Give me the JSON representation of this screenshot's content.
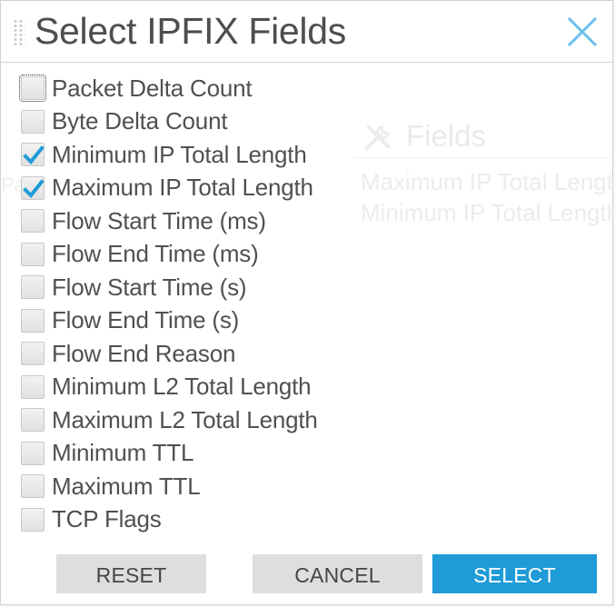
{
  "dialog": {
    "title": "Select IPFIX Fields",
    "close_icon": "close-icon",
    "accent_color": "#1f9bd7"
  },
  "fields": [
    {
      "label": "Packet Delta Count",
      "checked": false,
      "focused": true
    },
    {
      "label": "Byte Delta Count",
      "checked": false,
      "focused": false
    },
    {
      "label": "Minimum IP Total Length",
      "checked": true,
      "focused": false
    },
    {
      "label": "Maximum IP Total Length",
      "checked": true,
      "focused": false
    },
    {
      "label": "Flow Start Time (ms)",
      "checked": false,
      "focused": false
    },
    {
      "label": "Flow End Time (ms)",
      "checked": false,
      "focused": false
    },
    {
      "label": "Flow Start Time (s)",
      "checked": false,
      "focused": false
    },
    {
      "label": "Flow End Time (s)",
      "checked": false,
      "focused": false
    },
    {
      "label": "Flow End Reason",
      "checked": false,
      "focused": false
    },
    {
      "label": "Minimum L2 Total Length",
      "checked": false,
      "focused": false
    },
    {
      "label": "Maximum L2 Total Length",
      "checked": false,
      "focused": false
    },
    {
      "label": "Minimum TTL",
      "checked": false,
      "focused": false
    },
    {
      "label": "Maximum TTL",
      "checked": false,
      "focused": false
    },
    {
      "label": "TCP Flags",
      "checked": false,
      "focused": false
    }
  ],
  "background_panel": {
    "icon": "tools-icon",
    "title": "Fields",
    "items": [
      "Maximum IP Total Length",
      "Minimum IP Total Length"
    ],
    "left_fragment": "Pa"
  },
  "buttons": {
    "reset": "RESET",
    "cancel": "CANCEL",
    "select": "SELECT"
  }
}
